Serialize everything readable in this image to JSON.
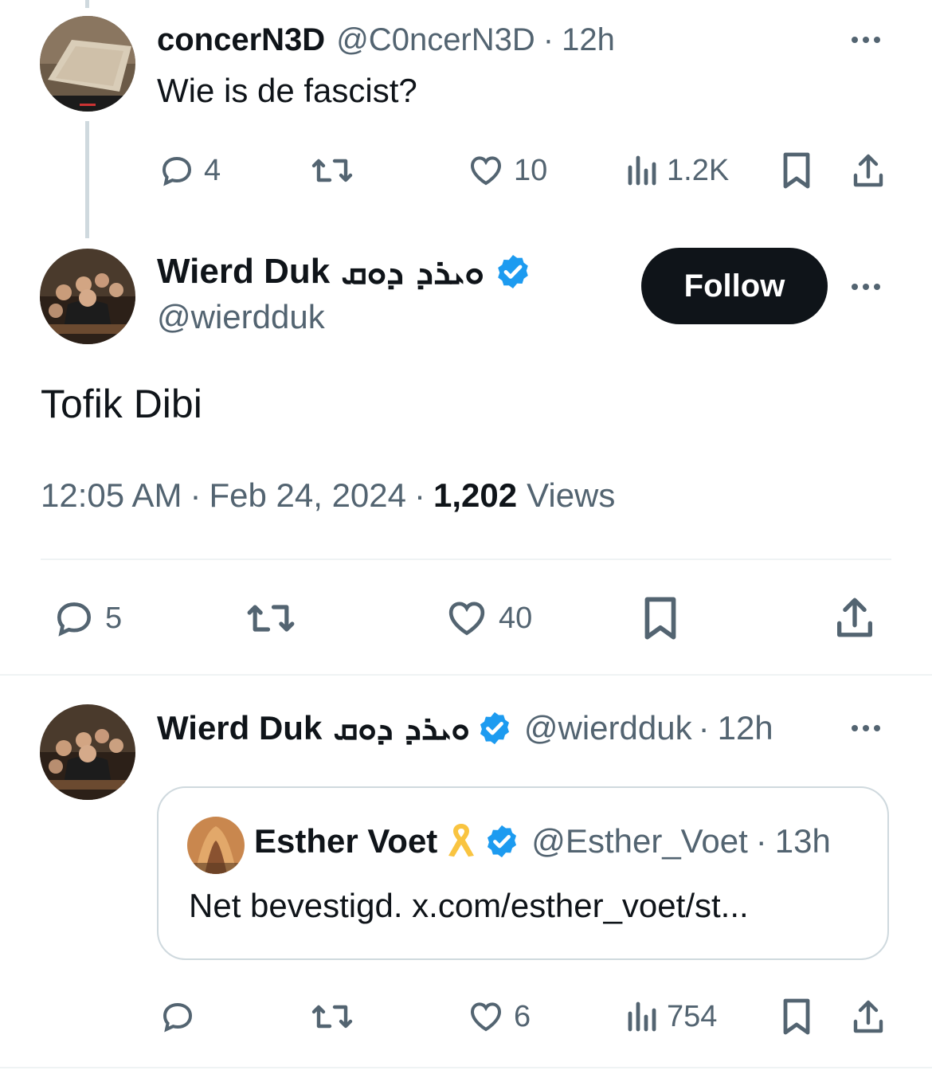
{
  "parent_tweet": {
    "name": "concerN3D",
    "handle": "@C0ncerN3D",
    "sep": "·",
    "time": "12h",
    "text": "Wie is de fascist?",
    "replies": "4",
    "likes": "10",
    "views": "1.2K"
  },
  "main_tweet": {
    "name": "Wierd Duk",
    "name_script": "ܘܝܪܕ ܕܘܩ",
    "handle": "@wierdduk",
    "follow_label": "Follow",
    "text": "Tofik Dibi",
    "time": "12:05 AM",
    "date": "Feb 24, 2024",
    "views_count": "1,202",
    "views_label": "Views",
    "replies": "5",
    "likes": "40",
    "sep": "·"
  },
  "reply_tweet": {
    "name": "Wierd Duk",
    "name_script": "ܘܝܪܕ ܕܘܩ",
    "handle": "@wierdduk",
    "sep": "·",
    "time": "12h",
    "likes": "6",
    "views": "754",
    "quote": {
      "name": "Esther Voet",
      "handle": "@Esther_Voet",
      "sep": "·",
      "time": "13h",
      "text": "Net bevestigd. x.com/esther_voet/st..."
    }
  },
  "colors": {
    "text": "#0f1419",
    "muted": "#536471",
    "verified": "#1d9bf0",
    "ribbon": "#f9c440",
    "follow_bg": "#0f1419",
    "border": "#cfd9de"
  },
  "icons": [
    "reply-icon",
    "retweet-icon",
    "like-icon",
    "views-icon",
    "bookmark-icon",
    "share-icon",
    "verified-icon",
    "ribbon-icon",
    "more-icon"
  ]
}
